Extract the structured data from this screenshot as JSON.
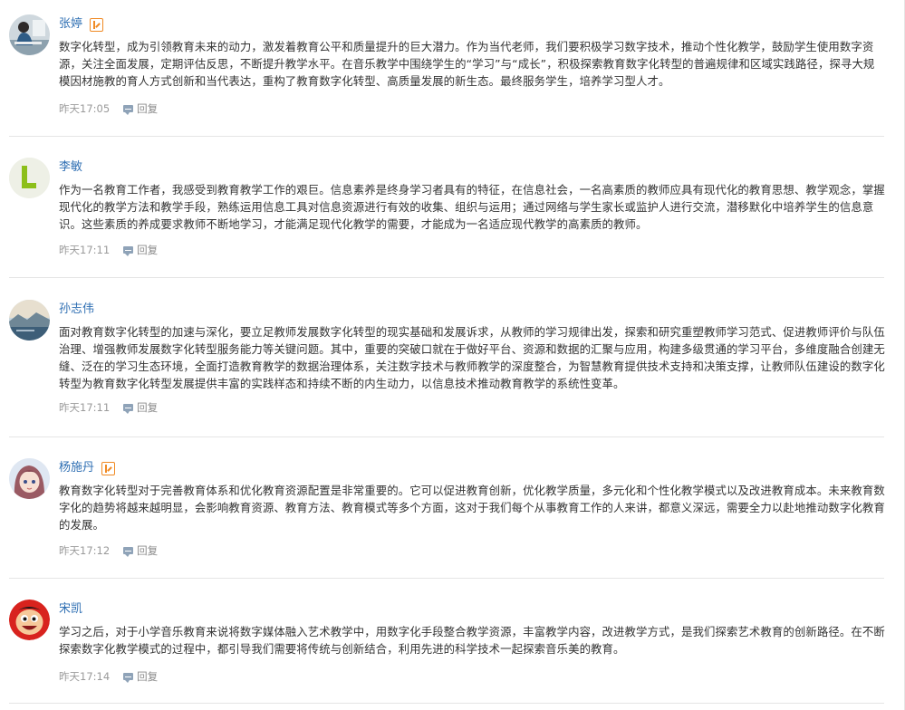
{
  "comments": [
    {
      "name": "张婷",
      "has_badge": true,
      "avatar_icon": "person-at-desk-avatar",
      "content": "数字化转型，成为引领教育未来的动力，激发着教育公平和质量提升的巨大潜力。作为当代老师，我们要积极学习数字技术，推动个性化教学，鼓励学生使用数字资源，关注全面发展，定期评估反思，不断提升教学水平。在音乐教学中围绕学生的“学习”与“成长”，积极探索教育数字化转型的普遍规律和区域实践路径，探寻大规模因材施教的育人方式创新和当代表达，重构了教育数字化转型、高质量发展的新生态。最终服务学生，培养学习型人才。",
      "time": "昨天17:05",
      "reply_label": "回复"
    },
    {
      "name": "李敏",
      "has_badge": false,
      "avatar_icon": "letter-l-avatar",
      "avatar_letter": "L",
      "content": "作为一名教育工作者，我感受到教育教学工作的艰巨。信息素养是终身学习者具有的特征，在信息社会，一名高素质的教师应具有现代化的教育思想、教学观念，掌握现代化的教学方法和教学手段，熟练运用信息工具对信息资源进行有效的收集、组织与运用；通过网络与学生家长或监护人进行交流，潜移默化中培养学生的信息意识。这些素质的养成要求教师不断地学习，才能满足现代化教学的需要，才能成为一名适应现代教学的高素质的教师。",
      "time": "昨天17:11",
      "reply_label": "回复"
    },
    {
      "name": "孙志伟",
      "has_badge": false,
      "avatar_icon": "landscape-avatar",
      "content": "面对教育数字化转型的加速与深化，要立足教师发展数字化转型的现实基础和发展诉求，从教师的学习规律出发，探索和研究重塑教师学习范式、促进教师评价与队伍治理、增强教师发展数字化转型服务能力等关键问题。其中，重要的突破口就在于做好平台、资源和数据的汇聚与应用，构建多级贯通的学习平台，多维度融合创建无缝、泛在的学习生态环境，全面打造教育教学的数据治理体系，关注数字技术与教师教学的深度整合，为智慧教育提供技术支持和决策支撑，让教师队伍建设的数字化转型为教育数字化转型发展提供丰富的实践样态和持续不断的内生动力，以信息技术推动教育教学的系统性变革。",
      "time": "昨天17:11",
      "reply_label": "回复"
    },
    {
      "name": "杨施丹",
      "has_badge": true,
      "avatar_icon": "anime-girl-avatar",
      "content": "教育数字化转型对于完善教育体系和优化教育资源配置是非常重要的。它可以促进教育创新，优化教学质量，多元化和个性化教学模式以及改进教育成本。未来教育数字化的趋势将越来越明显，会影响教育资源、教育方法、教育模式等多个方面，这对于我们每个从事教育工作的人来讲，都意义深远，需要全力以赴地推动数字化教育的发展。",
      "time": "昨天17:12",
      "reply_label": "回复"
    },
    {
      "name": "宋凯",
      "has_badge": false,
      "avatar_icon": "cartoon-face-avatar",
      "content": "学习之后，对于小学音乐教育来说将数字媒体融入艺术教学中，用数字化手段整合教学资源，丰富教学内容，改进教学方式，是我们探索艺术教育的创新路径。在不断探索数字化教学模式的过程中，都引导我们需要将传统与创新结合，利用先进的科学技术一起探索音乐美的教育。",
      "time": "昨天17:14",
      "reply_label": "回复"
    }
  ]
}
